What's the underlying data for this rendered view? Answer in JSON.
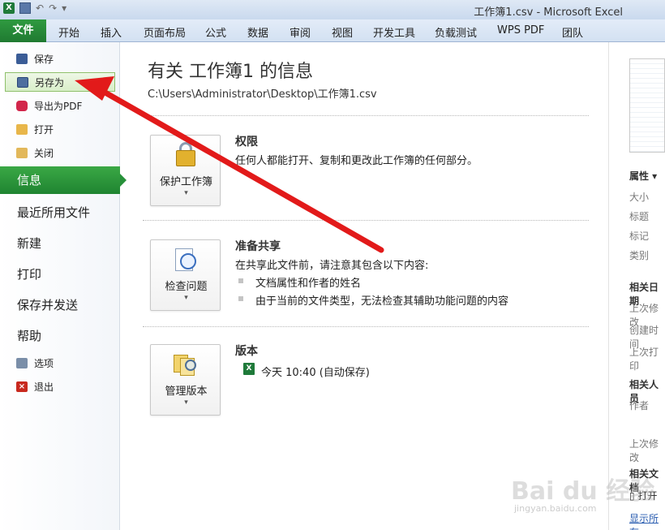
{
  "window": {
    "title": "工作簿1.csv - Microsoft Excel"
  },
  "ribbon": {
    "file_tab": "文件",
    "tabs": [
      "开始",
      "插入",
      "页面布局",
      "公式",
      "数据",
      "审阅",
      "视图",
      "开发工具",
      "负载测试",
      "WPS PDF",
      "团队"
    ]
  },
  "nav": {
    "save": "保存",
    "saveas": "另存为",
    "export_pdf": "导出为PDF",
    "open": "打开",
    "close": "关闭",
    "info": "信息",
    "recent": "最近所用文件",
    "new": "新建",
    "print": "打印",
    "save_send": "保存并发送",
    "help": "帮助",
    "options": "选项",
    "exit": "退出"
  },
  "main": {
    "title": "有关 工作簿1 的信息",
    "path": "C:\\Users\\Administrator\\Desktop\\工作簿1.csv",
    "permissions": {
      "button": "保护工作簿",
      "title": "权限",
      "text": "任何人都能打开、复制和更改此工作簿的任何部分。"
    },
    "prepare": {
      "button": "检查问题",
      "title": "准备共享",
      "text": "在共享此文件前，请注意其包含以下内容:",
      "bullets": [
        "文档属性和作者的姓名",
        "由于当前的文件类型，无法检查其辅助功能问题的内容"
      ]
    },
    "versions": {
      "button": "管理版本",
      "title": "版本",
      "item": "今天 10:40 (自动保存)"
    }
  },
  "right": {
    "properties": "属性 ▾",
    "size": "大小",
    "title_field": "标题",
    "tags": "标记",
    "category": "类别",
    "related_dates": "相关日期",
    "last_modified": "上次修改",
    "created": "创建时间",
    "last_printed": "上次打印",
    "related_people": "相关人员",
    "author": "作者",
    "last_modified_by": "上次修改",
    "related_docs": "相关文档",
    "open_location": "打开",
    "show_all": "显示所有"
  },
  "watermark": {
    "main": "Bai du 经验",
    "sub": "jingyan.baidu.com"
  },
  "colors": {
    "accent": "#2a9a3d",
    "arrow": "#e21a1a"
  }
}
